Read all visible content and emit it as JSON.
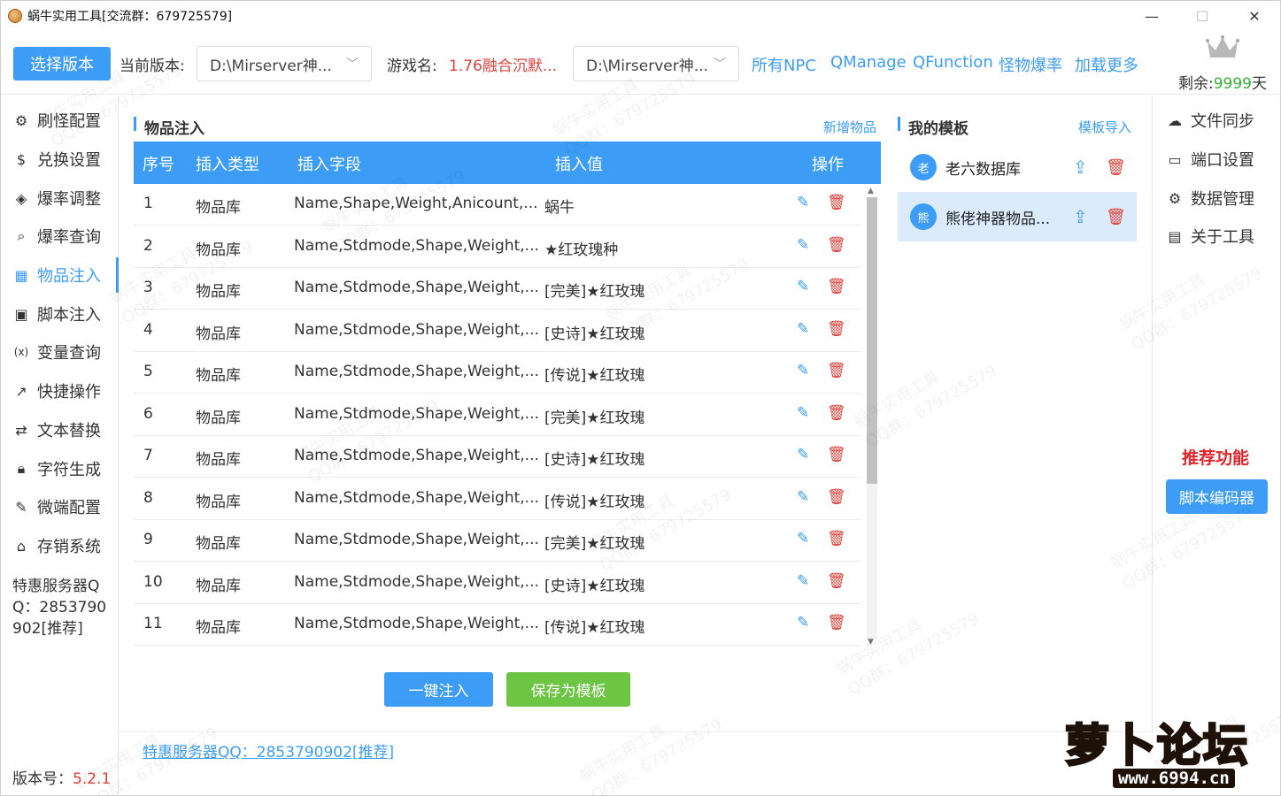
{
  "window": {
    "title": "蜗牛实用工具[交流群：679725579]",
    "minimize": "—",
    "maximize": "☐",
    "close": "✕"
  },
  "toolbar": {
    "select_version_button": "选择版本",
    "current_version_label": "当前版本:",
    "current_version_value": "D:\\Mirserver神...",
    "game_name_label": "游戏名:",
    "game_name_value": "1.76融合沉默...",
    "path_select_value": "D:\\Mirserver神...",
    "links": [
      "所有NPC",
      "QManage",
      "QFunction",
      "怪物爆率",
      "加载更多"
    ],
    "remain_label": "剩余:",
    "remain_value": "9999",
    "remain_unit": "天"
  },
  "sidebar": {
    "items": [
      {
        "label": "刷怪配置",
        "icon": "robot-icon"
      },
      {
        "label": "兑换设置",
        "icon": "dollar-icon"
      },
      {
        "label": "爆率调整",
        "icon": "cube-icon"
      },
      {
        "label": "爆率查询",
        "icon": "search-icon"
      },
      {
        "label": "物品注入",
        "icon": "qrcode-icon"
      },
      {
        "label": "脚本注入",
        "icon": "terminal-icon"
      },
      {
        "label": "变量查询",
        "icon": "variable-icon"
      },
      {
        "label": "快捷操作",
        "icon": "external-link-icon"
      },
      {
        "label": "文本替换",
        "icon": "swap-icon"
      },
      {
        "label": "字符生成",
        "icon": "lock-icon"
      },
      {
        "label": "微端配置",
        "icon": "brush-icon"
      },
      {
        "label": "存销系统",
        "icon": "store-icon"
      }
    ],
    "active_index": 4,
    "promo_text": "特惠服务器QQ：2853790902[推荐]",
    "version_label": "版本号：",
    "version_value": "5.2.1"
  },
  "items_section": {
    "title": "物品注入",
    "add_link": "新增物品",
    "columns": [
      "序号",
      "插入类型",
      "插入字段",
      "插入值",
      "操作"
    ],
    "rows": [
      {
        "no": "1",
        "type": "物品库",
        "field": "Name,Shape,Weight,Anicount,...",
        "value": "蜗牛"
      },
      {
        "no": "2",
        "type": "物品库",
        "field": "Name,Stdmode,Shape,Weight,...",
        "value": "★红玫瑰种"
      },
      {
        "no": "3",
        "type": "物品库",
        "field": "Name,Stdmode,Shape,Weight,...",
        "value": "[完美]★红玫瑰"
      },
      {
        "no": "4",
        "type": "物品库",
        "field": "Name,Stdmode,Shape,Weight,...",
        "value": "[史诗]★红玫瑰"
      },
      {
        "no": "5",
        "type": "物品库",
        "field": "Name,Stdmode,Shape,Weight,...",
        "value": "[传说]★红玫瑰"
      },
      {
        "no": "6",
        "type": "物品库",
        "field": "Name,Stdmode,Shape,Weight,...",
        "value": "[完美]★红玫瑰"
      },
      {
        "no": "7",
        "type": "物品库",
        "field": "Name,Stdmode,Shape,Weight,...",
        "value": "[史诗]★红玫瑰"
      },
      {
        "no": "8",
        "type": "物品库",
        "field": "Name,Stdmode,Shape,Weight,...",
        "value": "[传说]★红玫瑰"
      },
      {
        "no": "9",
        "type": "物品库",
        "field": "Name,Stdmode,Shape,Weight,...",
        "value": "[完美]★红玫瑰"
      },
      {
        "no": "10",
        "type": "物品库",
        "field": "Name,Stdmode,Shape,Weight,...",
        "value": "[史诗]★红玫瑰"
      },
      {
        "no": "11",
        "type": "物品库",
        "field": "Name,Stdmode,Shape,Weight,...",
        "value": "[传说]★红玫瑰"
      }
    ],
    "inject_button": "一键注入",
    "save_template_button": "保存为模板",
    "bottom_link": "特惠服务器QQ：2853790902[推荐]"
  },
  "templates_section": {
    "title": "我的模板",
    "import_link": "模板导入",
    "items": [
      {
        "avatar": "老",
        "name": "老六数据库",
        "selected": false
      },
      {
        "avatar": "熊",
        "name": "熊佬神器物品...",
        "selected": true
      }
    ]
  },
  "right_menu": {
    "items": [
      {
        "label": "文件同步",
        "icon": "cloud-upload-icon"
      },
      {
        "label": "端口设置",
        "icon": "port-icon"
      },
      {
        "label": "数据管理",
        "icon": "gear-icon"
      },
      {
        "label": "关于工具",
        "icon": "clipboard-icon"
      }
    ],
    "recommend_title": "推荐功能",
    "script_encoder_button": "脚本编码器"
  },
  "logo": {
    "brand": "萝卜论坛",
    "url": "www.6994.cn"
  },
  "watermark": {
    "line1": "蜗牛实用工具",
    "line2": "QQ群：679725579"
  },
  "colors": {
    "accent": "#3d9df6",
    "danger": "#e0413a",
    "success": "#6cc644",
    "remain": "#35b235"
  }
}
